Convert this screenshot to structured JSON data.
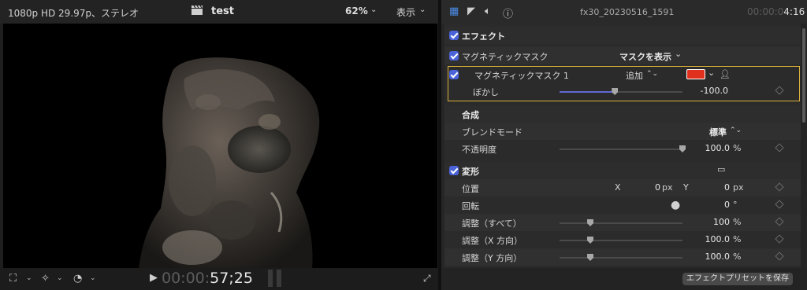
{
  "viewer": {
    "format": "1080p HD 29.97p、ステレオ",
    "project_title": "test",
    "zoom": "62%",
    "view_menu": "表示",
    "timecode_dim": "00:00:",
    "timecode_main": "57;25"
  },
  "inspector": {
    "clip_name": "fx30_20230516_1591",
    "duration_dim": "00:00:0",
    "duration_main": "4:16",
    "effects_header": "エフェクト",
    "magnetic_mask": {
      "label": "マグネティックマスク",
      "show_mask": "マスクを表示",
      "sub_label": "マグネティックマスク 1",
      "mode": "追加",
      "color": "#e0301e",
      "feather_label": "ぼかし",
      "feather_value": "-100.0",
      "feather_fraction": 0.45
    },
    "compositing": {
      "header": "合成",
      "blend_label": "ブレンドモード",
      "blend_value": "標準",
      "opacity_label": "不透明度",
      "opacity_value": "100.0",
      "opacity_unit": "%",
      "opacity_fraction": 1.0
    },
    "transform": {
      "header": "変形",
      "position_label": "位置",
      "x_label": "X",
      "x_value": "0",
      "x_unit": "px",
      "y_label": "Y",
      "y_value": "0",
      "y_unit": "px",
      "rotation_label": "回転",
      "rotation_value": "0",
      "rotation_unit": "°",
      "scale_all_label": "調整（すべて）",
      "scale_all_value": "100",
      "scale_all_unit": "%",
      "scale_x_label": "調整（X 方向）",
      "scale_x_value": "100.0",
      "scale_x_unit": "%",
      "scale_y_label": "調整（Y 方向）",
      "scale_y_value": "100.0",
      "scale_y_unit": "%",
      "scale_fraction": 0.25
    },
    "save_preset": "エフェクトプリセットを保存"
  },
  "colors": {
    "accent": "#4b63d8",
    "highlight_border": "#d9b13a"
  }
}
